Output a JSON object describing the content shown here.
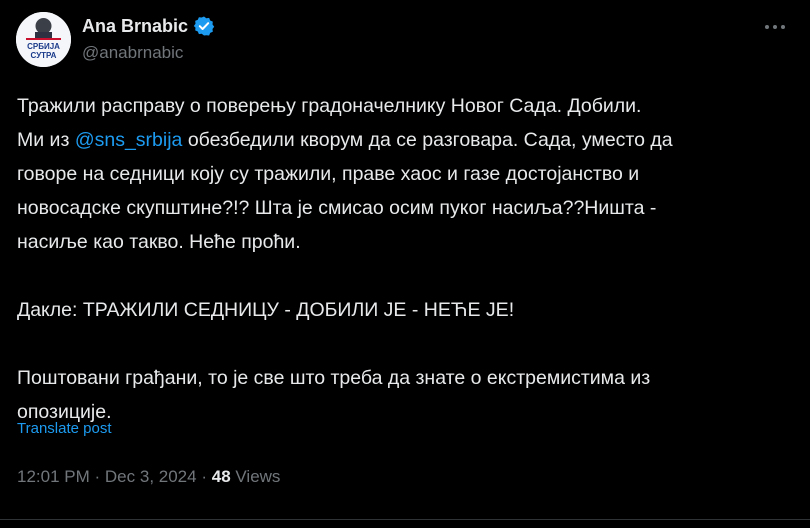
{
  "author": {
    "display_name": "Ana Brnabic",
    "handle": "@anabrnabic",
    "verified": true,
    "avatar_text_line1": "СРБИЈА",
    "avatar_text_line2": "СУТРА"
  },
  "tweet": {
    "line1": "Тражили расправу о поверењу градоначелнику Новог Сада. Добили.",
    "line2_pre": "Ми из ",
    "mention": "@sns_srbija",
    "line2_post": " обезбедили кворум да се разговара. Сада, уместо да",
    "line3": "говоре на седници коју су тражили, праве хаос и газе достојанство и",
    "line4": "новосадске скупштине?!? Шта је смисао осим пуког насиља??Ништа -",
    "line5": "насиље као такво. Неће проћи.",
    "line6": "Дакле: ТРАЖИЛИ СЕДНИЦУ - ДОБИЛИ ЈЕ - НЕЋЕ ЈЕ!",
    "line7": "Поштовани грађани, то је све што треба да знате о екстремистима из",
    "line8": "опозиције."
  },
  "translate_label": "Translate post",
  "meta": {
    "time": "12:01 PM",
    "separator": "·",
    "date": "Dec 3, 2024",
    "views_count": "48",
    "views_label": "Views"
  },
  "colors": {
    "background": "#000000",
    "text": "#e7e9ea",
    "muted": "#71767b",
    "accent": "#1d9bf0"
  }
}
